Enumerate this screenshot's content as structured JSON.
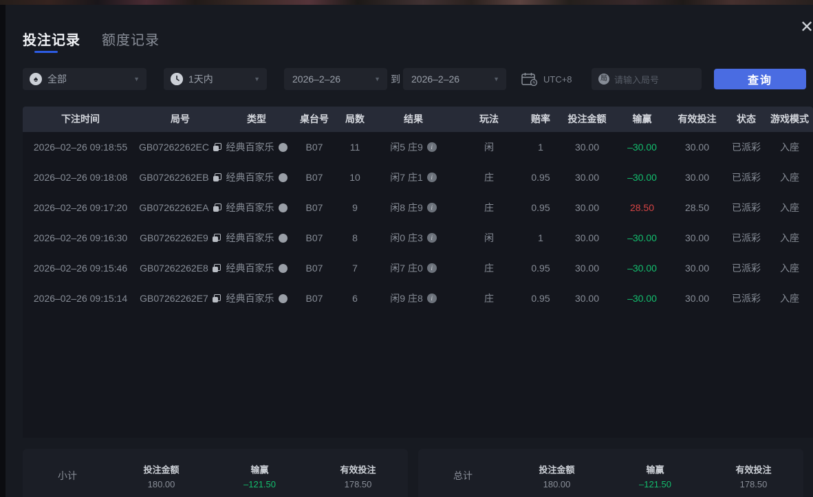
{
  "modal": {
    "close_icon": "✕"
  },
  "tabs": [
    {
      "label": "投注记录"
    },
    {
      "label": "额度记录"
    }
  ],
  "filters": {
    "game_type_value": "全部",
    "game_type_icon_char": "♠",
    "time_range_value": "1天内",
    "date_from": "2026–2–26",
    "to_label": "到",
    "date_to": "2026–2–26",
    "timezone_label": "UTC+8",
    "search_icon_char": "局",
    "search_placeholder": "请输入局号",
    "query_button_label": "查询",
    "chevron_char": "▼"
  },
  "table": {
    "headers": [
      "下注时间",
      "局号",
      "类型",
      "桌台号",
      "局数",
      "结果",
      "玩法",
      "赔率",
      "投注金额",
      "输赢",
      "有效投注",
      "状态",
      "游戏模式"
    ],
    "rows": [
      {
        "time": "2026–02–26 09:18:55",
        "round_id": "GB07262262EC",
        "type": "经典百家乐",
        "table_no": "B07",
        "rounds": "11",
        "result": "闲5 庄9",
        "play": "闲",
        "odds": "1",
        "bet_amount": "30.00",
        "win_loss": "–30.00",
        "win_loss_color": "green",
        "valid_bet": "30.00",
        "status": "已派彩",
        "mode": "入座"
      },
      {
        "time": "2026–02–26 09:18:08",
        "round_id": "GB07262262EB",
        "type": "经典百家乐",
        "table_no": "B07",
        "rounds": "10",
        "result": "闲7 庄1",
        "play": "庄",
        "odds": "0.95",
        "bet_amount": "30.00",
        "win_loss": "–30.00",
        "win_loss_color": "green",
        "valid_bet": "30.00",
        "status": "已派彩",
        "mode": "入座"
      },
      {
        "time": "2026–02–26 09:17:20",
        "round_id": "GB07262262EA",
        "type": "经典百家乐",
        "table_no": "B07",
        "rounds": "9",
        "result": "闲8 庄9",
        "play": "庄",
        "odds": "0.95",
        "bet_amount": "30.00",
        "win_loss": "28.50",
        "win_loss_color": "red",
        "valid_bet": "28.50",
        "status": "已派彩",
        "mode": "入座"
      },
      {
        "time": "2026–02–26 09:16:30",
        "round_id": "GB07262262E9",
        "type": "经典百家乐",
        "table_no": "B07",
        "rounds": "8",
        "result": "闲0 庄3",
        "play": "闲",
        "odds": "1",
        "bet_amount": "30.00",
        "win_loss": "–30.00",
        "win_loss_color": "green",
        "valid_bet": "30.00",
        "status": "已派彩",
        "mode": "入座"
      },
      {
        "time": "2026–02–26 09:15:46",
        "round_id": "GB07262262E8",
        "type": "经典百家乐",
        "table_no": "B07",
        "rounds": "7",
        "result": "闲7 庄0",
        "play": "庄",
        "odds": "0.95",
        "bet_amount": "30.00",
        "win_loss": "–30.00",
        "win_loss_color": "green",
        "valid_bet": "30.00",
        "status": "已派彩",
        "mode": "入座"
      },
      {
        "time": "2026–02–26 09:15:14",
        "round_id": "GB07262262E7",
        "type": "经典百家乐",
        "table_no": "B07",
        "rounds": "6",
        "result": "闲9 庄8",
        "play": "庄",
        "odds": "0.95",
        "bet_amount": "30.00",
        "win_loss": "–30.00",
        "win_loss_color": "green",
        "valid_bet": "30.00",
        "status": "已派彩",
        "mode": "入座"
      }
    ]
  },
  "summary": {
    "subtotal": {
      "title": "小计",
      "items": [
        {
          "label": "投注金额",
          "value": "180.00"
        },
        {
          "label": "输赢",
          "value": "–121.50"
        },
        {
          "label": "有效投注",
          "value": "178.50"
        }
      ]
    },
    "total": {
      "title": "总计",
      "items": [
        {
          "label": "投注金额",
          "value": "180.00"
        },
        {
          "label": "输赢",
          "value": "–121.50"
        },
        {
          "label": "有效投注",
          "value": "178.50"
        }
      ]
    }
  },
  "colors": {
    "accent_blue": "#4a6ce2",
    "loss_green": "#13bf6e",
    "win_red": "#d64444",
    "panel_bg": "#171a21"
  }
}
